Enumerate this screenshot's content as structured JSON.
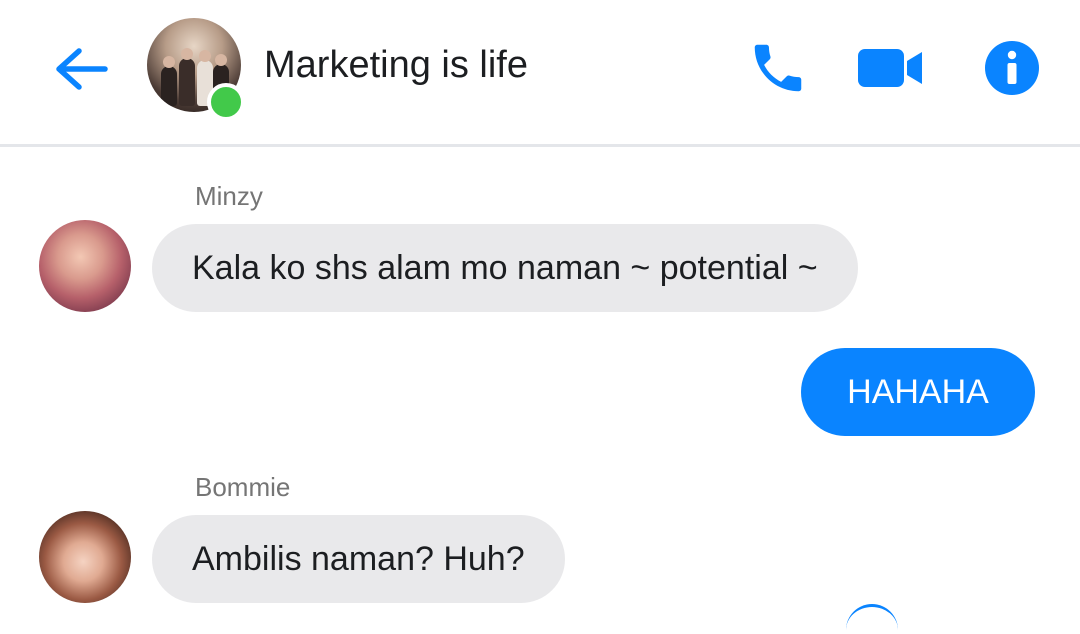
{
  "header": {
    "title": "Marketing is life",
    "back_icon": "arrow-left-icon",
    "call_icon": "phone-icon",
    "video_icon": "video-camera-icon",
    "info_icon": "info-icon",
    "accent_color": "#0a84ff",
    "online_color": "#42c94a"
  },
  "messages": [
    {
      "sender": "Minzy",
      "text": "Kala ko shs alam mo naman ~ potential ~",
      "direction": "incoming"
    },
    {
      "sender": "",
      "text": "HAHAHA",
      "direction": "outgoing"
    },
    {
      "sender": "Bommie",
      "text": "Ambilis naman? Huh?",
      "direction": "incoming"
    }
  ],
  "colors": {
    "incoming_bubble": "#e9e9eb",
    "outgoing_bubble": "#0a84ff",
    "sender_name": "#757575"
  }
}
